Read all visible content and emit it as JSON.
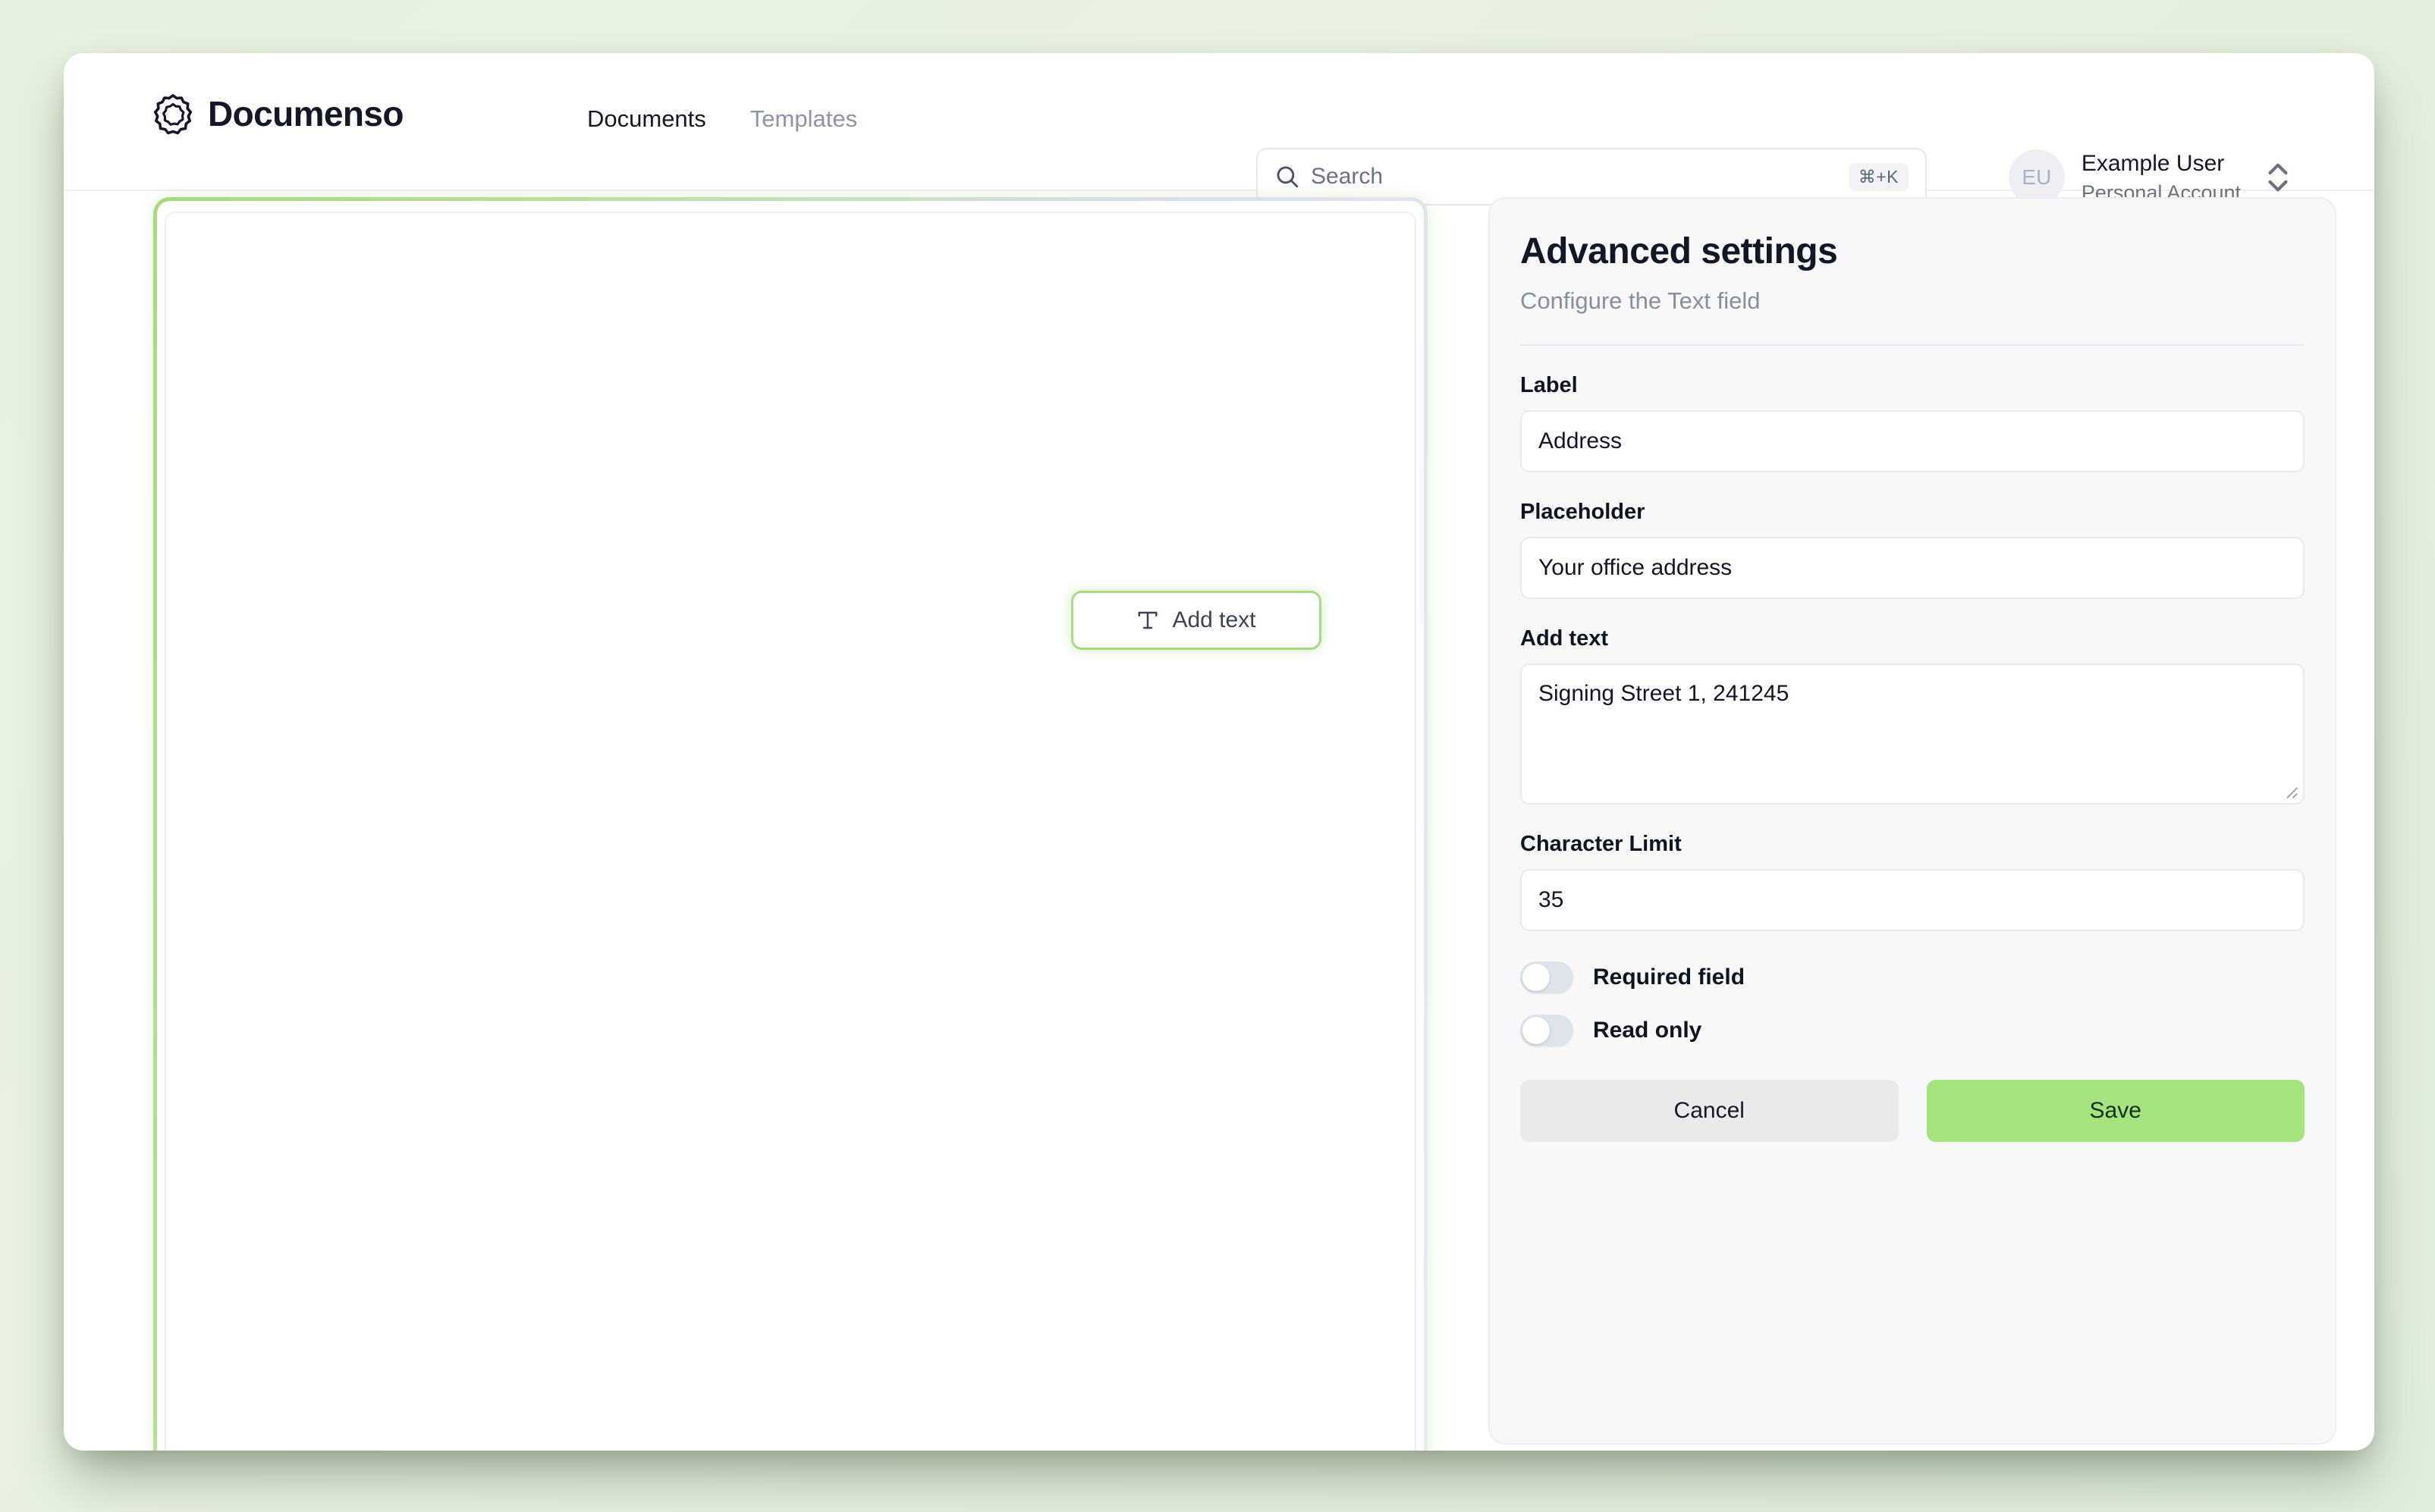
{
  "brand": {
    "name": "Documenso",
    "logo_icon": "documenso-rosette-logo"
  },
  "nav": {
    "items": [
      {
        "label": "Documents",
        "active": true
      },
      {
        "label": "Templates",
        "active": false
      }
    ]
  },
  "search": {
    "icon": "search-icon",
    "placeholder": "Search",
    "shortcut": "⌘+K"
  },
  "user": {
    "initials": "EU",
    "name": "Example User",
    "account_type": "Personal Account",
    "switcher_icon": "chevron-up-down-icon"
  },
  "editor": {
    "field_chip": {
      "icon": "text-field-icon",
      "label": "Add text"
    }
  },
  "settings": {
    "title": "Advanced settings",
    "subtitle": "Configure the Text field",
    "fields": {
      "label": {
        "label": "Label",
        "value": "Address"
      },
      "placeholder": {
        "label": "Placeholder",
        "value": "Your office address"
      },
      "add_text": {
        "label": "Add text",
        "value": "Signing Street 1, 241245"
      },
      "character_limit": {
        "label": "Character Limit",
        "value": "35"
      }
    },
    "toggles": [
      {
        "label": "Required field",
        "on": false
      },
      {
        "label": "Read only",
        "on": false
      }
    ],
    "buttons": {
      "cancel": "Cancel",
      "save": "Save"
    }
  },
  "colors": {
    "brand_green": "#a4e47c",
    "field_border_green": "#a7db84",
    "text_dark": "#131626",
    "text_muted": "#868e9f",
    "page_background": "#e6f2df"
  }
}
